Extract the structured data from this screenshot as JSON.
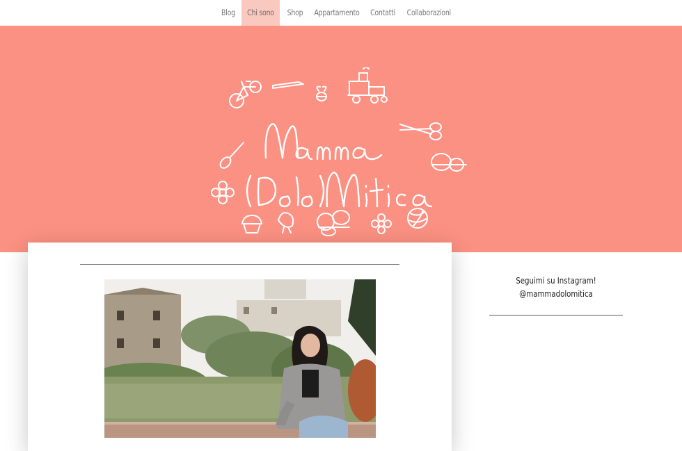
{
  "nav": {
    "items": [
      {
        "label": "Blog"
      },
      {
        "label": "Chi sono"
      },
      {
        "label": "Shop"
      },
      {
        "label": "Appartamento"
      },
      {
        "label": "Contatti"
      },
      {
        "label": "Collaborazioni"
      }
    ],
    "active_index": 1
  },
  "hero": {
    "logo_text": "Mamma (Dolo)Mitica",
    "background": "#fb9183"
  },
  "sidebar": {
    "line1": "Seguimi su Instagram!",
    "line2": "@mammadolomitica"
  },
  "colors": {
    "accent": "#fb9183",
    "nav_active": "#f9c9c0"
  }
}
